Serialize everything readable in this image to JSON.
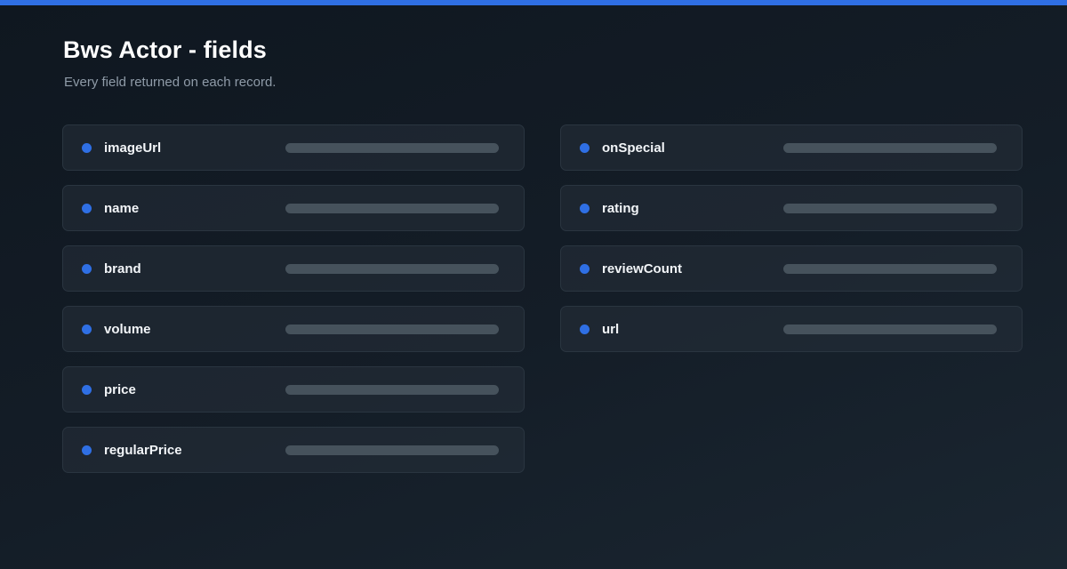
{
  "header": {
    "title": "Bws Actor - fields",
    "subtitle": "Every field returned on each record."
  },
  "colors": {
    "accent": "#2f6fe4",
    "background": "#141d27",
    "card_background": "#1f2830",
    "card_border": "#2a3540",
    "placeholder_bar": "#46525c"
  },
  "fields_left": [
    {
      "name": "imageUrl"
    },
    {
      "name": "name"
    },
    {
      "name": "brand"
    },
    {
      "name": "volume"
    },
    {
      "name": "price"
    },
    {
      "name": "regularPrice"
    }
  ],
  "fields_right": [
    {
      "name": "onSpecial"
    },
    {
      "name": "rating"
    },
    {
      "name": "reviewCount"
    },
    {
      "name": "url"
    }
  ]
}
